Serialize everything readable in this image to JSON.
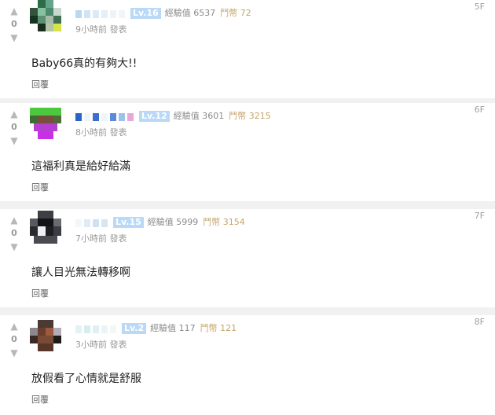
{
  "ui": {
    "upvote_glyph": "▲",
    "downvote_glyph": "▼",
    "reply_label": "回覆",
    "colors": {
      "level_badge": "#b9d9f7",
      "coins": "#c4a56a",
      "card": "#ffffff",
      "page": "#f1f1f1"
    }
  },
  "comments": [
    {
      "score": "0",
      "level": "Lv.16",
      "exp": "經驗值 6537",
      "coins": "鬥幣 72",
      "time": "9小時前 發表",
      "floor": "5F",
      "content": "Baby66真的有夠大!!"
    },
    {
      "score": "0",
      "level": "Lv.12",
      "exp": "經驗值 3601",
      "coins": "鬥幣 3215",
      "time": "8小時前 發表",
      "floor": "6F",
      "content": "這福利真是給好給滿"
    },
    {
      "score": "0",
      "level": "Lv.15",
      "exp": "經驗值 5999",
      "coins": "鬥幣 3154",
      "time": "7小時前 發表",
      "floor": "7F",
      "content": "讓人目光無法轉移啊"
    },
    {
      "score": "0",
      "level": "Lv.2",
      "exp": "經驗值 117",
      "coins": "鬥幣 121",
      "time": "3小時前 發表",
      "floor": "8F",
      "content": "放假看了心情就是舒服"
    }
  ]
}
